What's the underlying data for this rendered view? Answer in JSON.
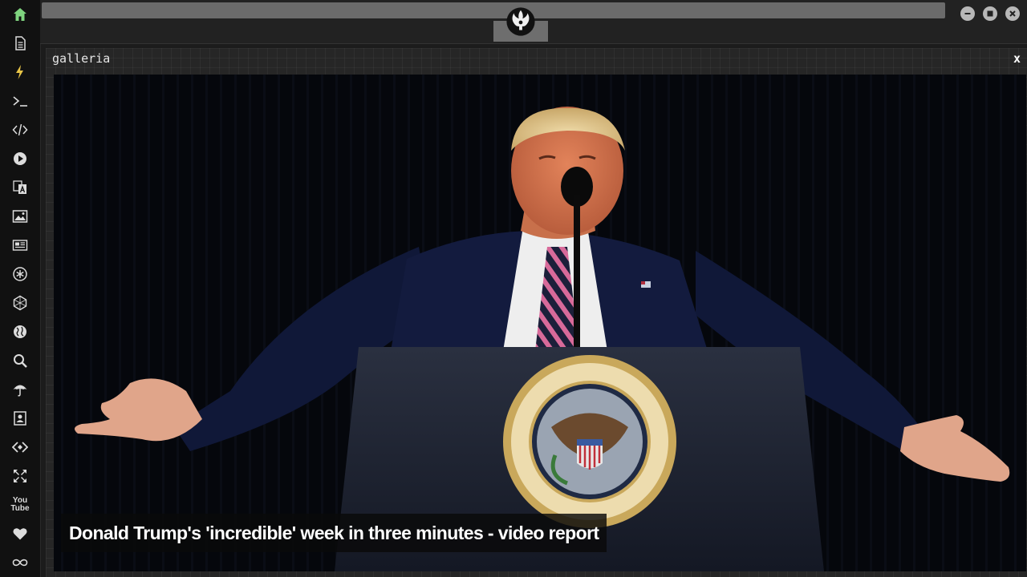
{
  "sidebar": {
    "items": [
      {
        "name": "home-icon",
        "label": "Home"
      },
      {
        "name": "document-icon",
        "label": "Document"
      },
      {
        "name": "lightning-icon",
        "label": "Lightning"
      },
      {
        "name": "terminal-icon",
        "label": ">_"
      },
      {
        "name": "code-icon",
        "label": "</>"
      },
      {
        "name": "play-icon",
        "label": "Play"
      },
      {
        "name": "translate-icon",
        "label": "Translate"
      },
      {
        "name": "image-icon",
        "label": "Image"
      },
      {
        "name": "newspaper-icon",
        "label": "News"
      },
      {
        "name": "asterisk-icon",
        "label": "Asterisk"
      },
      {
        "name": "hexagon-icon",
        "label": "Hexagon"
      },
      {
        "name": "globe-icon",
        "label": "Globe"
      },
      {
        "name": "search-icon",
        "label": "Search"
      },
      {
        "name": "umbrella-icon",
        "label": "Umbrella"
      },
      {
        "name": "contact-card-icon",
        "label": "Contacts"
      },
      {
        "name": "code-diamond-icon",
        "label": "Code diamond"
      },
      {
        "name": "expand-icon",
        "label": "Expand"
      },
      {
        "name": "youtube-icon",
        "label": "YouTube"
      },
      {
        "name": "heart-icon",
        "label": "Heart"
      },
      {
        "name": "infinity-icon",
        "label": "Infinity"
      }
    ]
  },
  "window": {
    "logo_icon": "rebel-alliance-icon",
    "buttons": [
      "minimize-icon",
      "maximize-icon",
      "close-icon"
    ]
  },
  "panel": {
    "title": "galleria",
    "close_label": "x",
    "caption": "Donald Trump's 'incredible' week in three minutes - video report"
  },
  "colors": {
    "accent_home": "#7fd47f",
    "accent_bolt": "#e8c547",
    "background": "#1c1c1c"
  }
}
